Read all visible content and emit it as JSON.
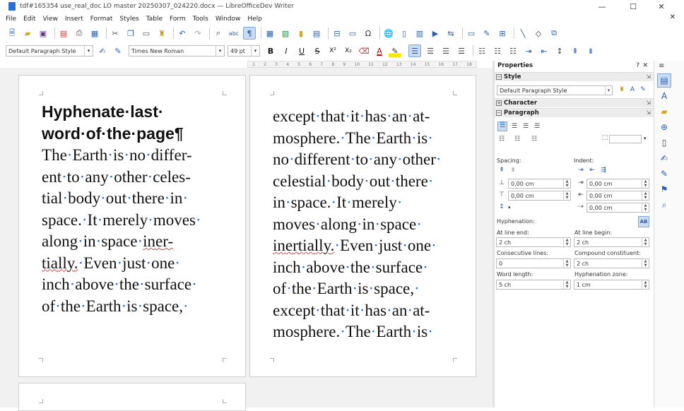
{
  "window": {
    "title": "tdf#165354 use_real_doc LO master 20250307_024220.docx — LibreOfficeDev Writer",
    "minimize": "—",
    "maximize": "☐",
    "close": "✕"
  },
  "menu": {
    "items": [
      "File",
      "Edit",
      "View",
      "Insert",
      "Format",
      "Styles",
      "Table",
      "Form",
      "Tools",
      "Window",
      "Help"
    ],
    "close": "✕"
  },
  "formatting": {
    "paragraph_style": "Default Paragraph Style",
    "font_name": "Times New Roman",
    "font_size": "49 pt",
    "bold": "B",
    "italic": "I",
    "underline": "U",
    "strike": "S",
    "superscript": "X²",
    "subscript": "X₂"
  },
  "ruler": {
    "ticks": [
      "1",
      "1",
      "2",
      "3",
      "4",
      "5",
      "6",
      "7",
      "8",
      "9",
      "10",
      "11",
      "12",
      "13",
      "14",
      "15",
      "16",
      "17",
      "18"
    ]
  },
  "page1": {
    "heading": [
      "Hyphenate·last·",
      "word·of·the·page¶"
    ],
    "lines": [
      [
        {
          "t": "The·Earth·is·no·differ-"
        }
      ],
      [
        {
          "t": "ent·to·any·other·celes-"
        }
      ],
      [
        {
          "t": "tial·body·out·there·in·"
        }
      ],
      [
        {
          "t": "space.·It·merely·moves·"
        }
      ],
      [
        {
          "t": "along·in·space·"
        },
        {
          "t": "iner-",
          "s": true
        }
      ],
      [
        {
          "t": "tially.",
          "s": true
        },
        {
          "t": "·Even·just·one·"
        }
      ],
      [
        {
          "t": "inch·above·the·surface·"
        }
      ],
      [
        {
          "t": "of·the·Earth·is·space,·"
        }
      ]
    ]
  },
  "page2": {
    "lines": [
      [
        {
          "t": "except·that·it·has·an·at-"
        }
      ],
      [
        {
          "t": "mosphere.·The·Earth·is·"
        }
      ],
      [
        {
          "t": "no·different·to·any·other·"
        }
      ],
      [
        {
          "t": "celestial·body·out·there·"
        }
      ],
      [
        {
          "t": "in·space.·It·merely·"
        }
      ],
      [
        {
          "t": "moves·along·in·space·"
        }
      ],
      [
        {
          "t": "inertially.",
          "s": true
        },
        {
          "t": "·Even·just·one·"
        }
      ],
      [
        {
          "t": "inch·above·the·surface·"
        }
      ],
      [
        {
          "t": "of·the·Earth·is·space,·"
        }
      ],
      [
        {
          "t": "except·that·it·has·an·at-"
        }
      ],
      [
        {
          "t": "mosphere.·The·Earth·is·"
        }
      ]
    ]
  },
  "sidebar": {
    "title": "Properties",
    "style_section": "Style",
    "style_value": "Default Paragraph Style",
    "character_section": "Character",
    "paragraph_section": "Paragraph",
    "spacing_label": "Spacing:",
    "indent_label": "Indent:",
    "spacing_above": "0,00 cm",
    "spacing_below": "0,00 cm",
    "indent_before": "0,00 cm",
    "indent_after": "0,00 cm",
    "indent_first": "0,00 cm",
    "hyphenation_label": "Hyphenation:",
    "at_line_end_label": "At line end:",
    "at_line_end": "2 ch",
    "at_line_begin_label": "At line begin:",
    "at_line_begin": "2 ch",
    "consecutive_label": "Consecutive lines:",
    "consecutive": "0",
    "compound_label": "Compound constituent:",
    "compound": "2 ch",
    "word_length_label": "Word length:",
    "word_length": "5 ch",
    "zone_label": "Hyphenation zone:",
    "zone": "1 cm",
    "hyphen_toggle": "AB"
  }
}
